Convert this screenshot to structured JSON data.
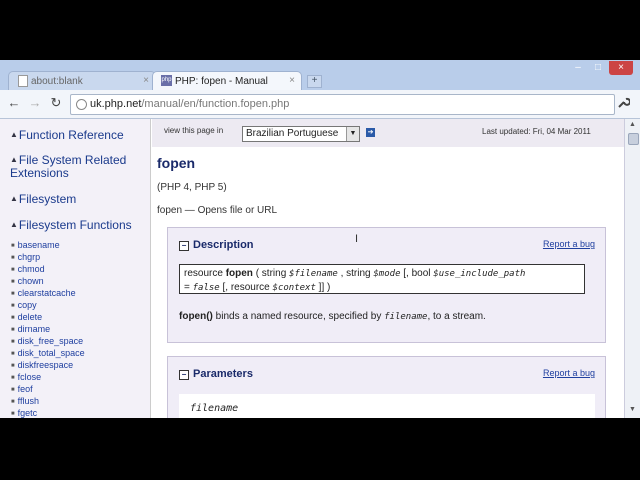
{
  "tabs": [
    {
      "title": "about:blank",
      "close": "×"
    },
    {
      "title": "PHP: fopen - Manual",
      "close": "×",
      "favicon": "php"
    }
  ],
  "window": {
    "min": "–",
    "max": "□",
    "close": "×"
  },
  "toolbar": {
    "back": "←",
    "forward": "→",
    "reload": "↻",
    "url_host": "uk.php.net",
    "url_path": "/manual/en/function.fopen.php",
    "star": "☆",
    "wrench": "🔧"
  },
  "sidebar": {
    "headings": [
      {
        "label": "Function Reference"
      },
      {
        "label": "File System Related Extensions"
      },
      {
        "label": "Filesystem"
      },
      {
        "label": "Filesystem Functions"
      }
    ],
    "items": [
      "basename",
      "chgrp",
      "chmod",
      "chown",
      "clearstatcache",
      "copy",
      "delete",
      "dirname",
      "disk_free_space",
      "disk_total_space",
      "diskfreespace",
      "fclose",
      "feof",
      "fflush",
      "fgetc"
    ]
  },
  "main": {
    "view_label": "view this page in",
    "language": "Brazilian Portuguese",
    "updated": "Last updated: Fri, 04 Mar 2011",
    "title": "fopen",
    "version": "(PHP 4, PHP 5)",
    "purpose": "fopen — Opens file or URL",
    "description": {
      "heading": "Description",
      "report": "Report a bug",
      "sig_type": "resource",
      "sig_name": "fopen",
      "sig_rest1": "( string",
      "p1": "$filename",
      "sig_rest2": ", string",
      "p2": "$mode",
      "sig_rest3": "[, bool",
      "p3": "$use_include_path",
      "sig_line2a": "=",
      "default": "false",
      "sig_line2b": "[, resource",
      "p4": "$context",
      "sig_line2c": "]] )",
      "text_fn": "fopen()",
      "text_mid": " binds a named resource, specified by ",
      "text_param": "filename",
      "text_end": ", to a stream."
    },
    "parameters": {
      "heading": "Parameters",
      "report": "Report a bug",
      "first": "filename"
    }
  }
}
